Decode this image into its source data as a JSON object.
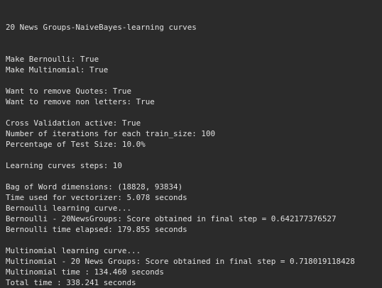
{
  "console": {
    "lines": [
      "20 News Groups-NaiveBayes-learning curves",
      "",
      "",
      "Make Bernoulli: True",
      "Make Multinomial: True",
      "",
      "Want to remove Quotes: True",
      "Want to remove non letters: True",
      "",
      "Cross Validation active: True",
      "Number of iterations for each train_size: 100",
      "Percentage of Test Size: 10.0%",
      "",
      "Learning curves steps: 10",
      "",
      "Bag of Word dimensions: (18828, 93834)",
      "Time used for vectorizer: 5.078 seconds",
      "Bernoulli learning curve...",
      "Bernoulli - 20NewsGroups: Score obtained in final step = 0.642177376527",
      "Bernoulli time elapsed: 179.855 seconds",
      "",
      "Multinomial learning curve...",
      "Multinomial - 20 News Groups: Score obtained in final step = 0.718019118428",
      "Multinomial time : 134.460 seconds",
      "Total time : 338.241 seconds"
    ]
  }
}
